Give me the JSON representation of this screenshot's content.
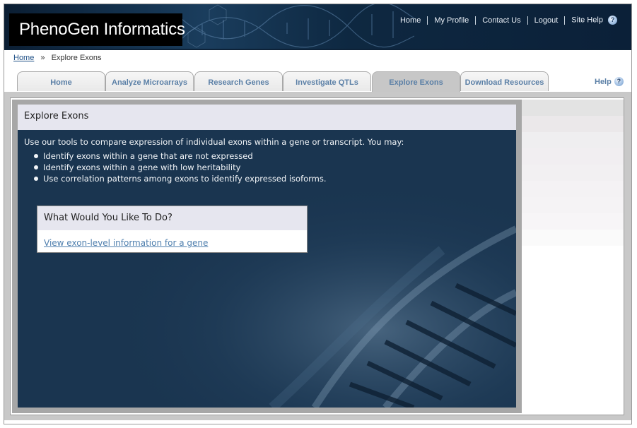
{
  "app": {
    "title": "PhenoGen Informatics"
  },
  "top_nav": [
    {
      "label": "Home"
    },
    {
      "label": "My Profile"
    },
    {
      "label": "Contact Us"
    },
    {
      "label": "Logout"
    },
    {
      "label": "Site Help"
    }
  ],
  "breadcrumb": {
    "home": "Home",
    "separator": "»",
    "current": "Explore Exons"
  },
  "tabs": [
    {
      "label": "Home",
      "active": false
    },
    {
      "label": "Analyze Microarrays",
      "active": false
    },
    {
      "label": "Research Genes",
      "active": false
    },
    {
      "label": "Investigate QTLs",
      "active": false
    },
    {
      "label": "Explore Exons",
      "active": true
    },
    {
      "label": "Download Resources",
      "active": false
    }
  ],
  "page_help": {
    "label": "Help"
  },
  "content": {
    "section_title": "Explore Exons",
    "intro": "Use our tools to compare expression of individual exons within a gene or transcript. You may:",
    "bullets": [
      "Identify exons within a gene that are not expressed",
      "Identify exons within a gene with low heritability",
      "Use correlation patterns among exons to identify expressed isoforms."
    ],
    "todo": {
      "title": "What Would You Like To Do?",
      "link": "View exon-level information for a gene"
    }
  },
  "colors": {
    "header_bg": "#13304c",
    "tab_text": "#5a7fa6",
    "content_dark": "#1a3550",
    "panel_header": "#e6e6ef",
    "link": "#4f7fae"
  }
}
